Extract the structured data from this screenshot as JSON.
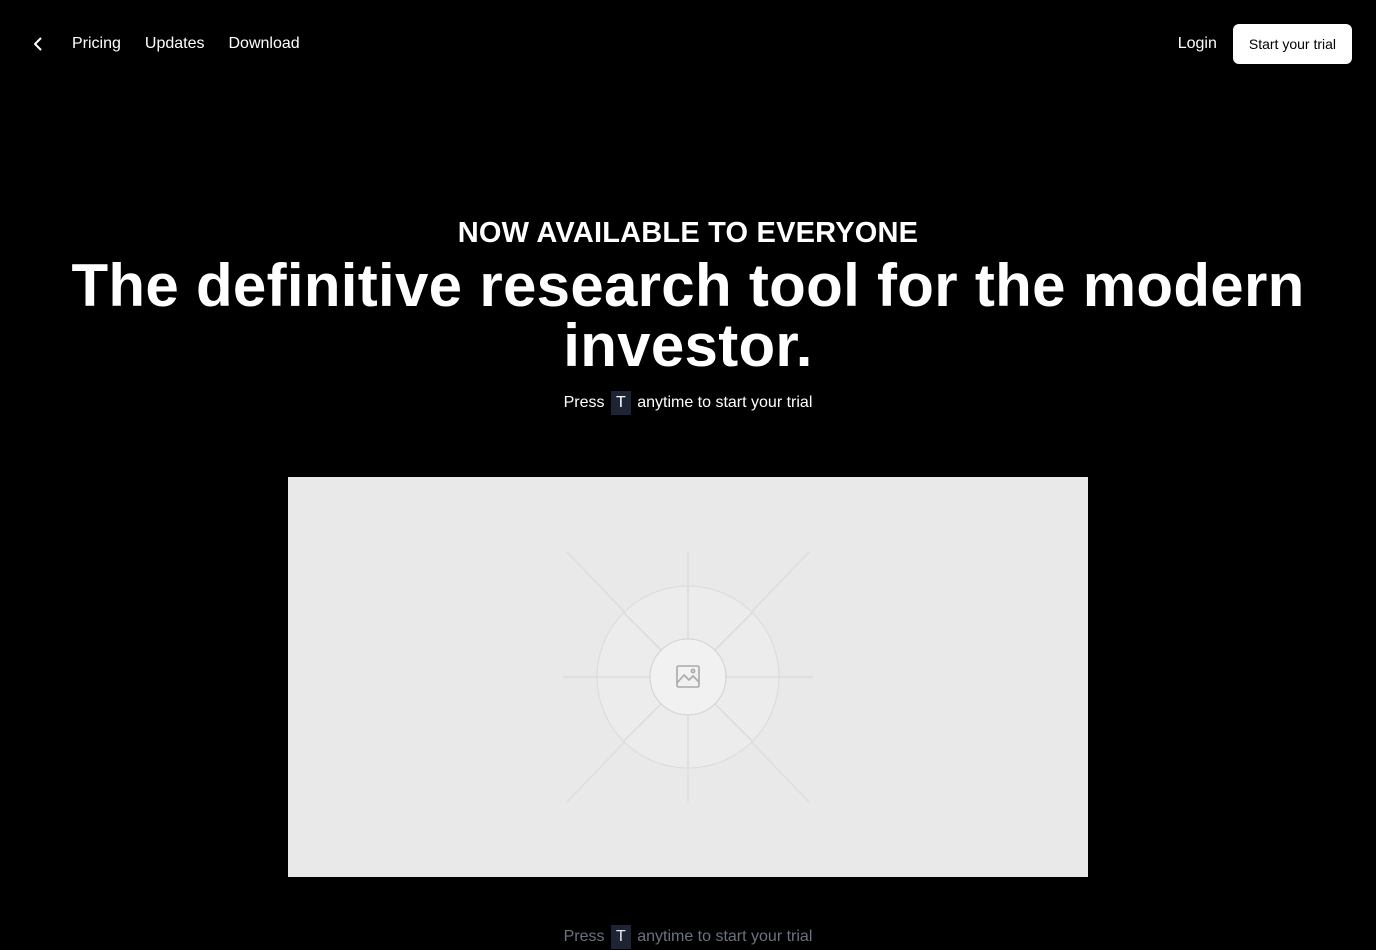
{
  "nav": {
    "back_icon": "chevron-left-icon",
    "links": [
      "Pricing",
      "Updates",
      "Download"
    ],
    "login": "Login",
    "cta": "Start your trial"
  },
  "hero": {
    "eyebrow": "NOW AVAILABLE TO EVERYONE",
    "headline": "The definitive research tool for the modern investor.",
    "hint": {
      "before": "Press",
      "key": "T",
      "after": "anytime to start your trial"
    }
  },
  "media": {
    "icon": "image-placeholder-icon"
  },
  "footer_hint": {
    "before": "Press",
    "key": "T",
    "after": "anytime to start your trial"
  },
  "colors": {
    "background": "#000000",
    "text": "#ffffff",
    "button_bg": "#ffffff",
    "button_text": "#000000",
    "key_bg": "#1e2433",
    "placeholder_bg": "#e9e9e9"
  }
}
